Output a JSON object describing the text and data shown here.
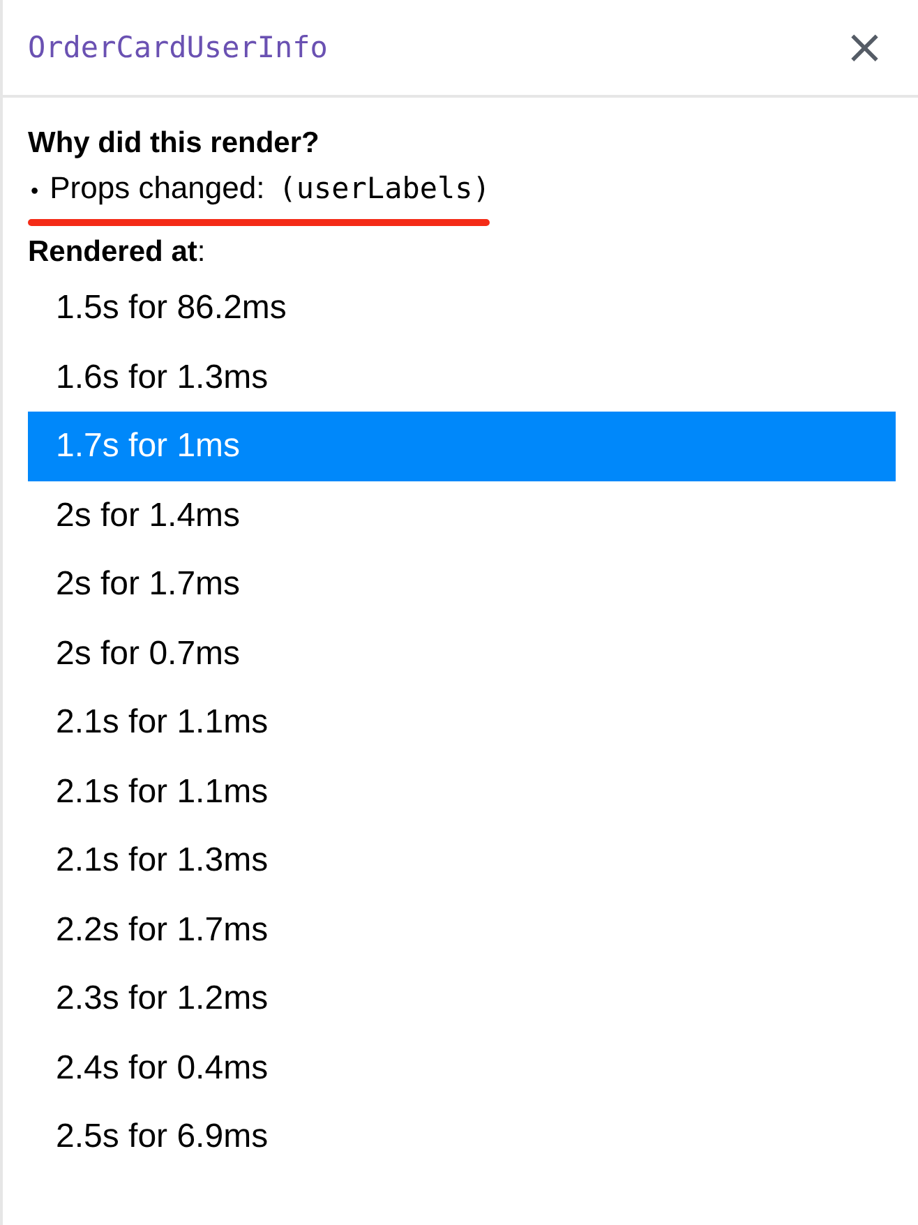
{
  "header": {
    "title": "OrderCardUserInfo",
    "close": "×"
  },
  "why": {
    "heading": "Why did this render?",
    "reasons": [
      {
        "bullet": "•",
        "label": "Props changed:",
        "value": "(userLabels)",
        "underlined": true
      }
    ]
  },
  "renders": {
    "heading": "**Rendered at**:",
    "items": [
      {
        "label": "1.5s for 86.2ms",
        "selected": false
      },
      {
        "label": "1.6s for 1.3ms",
        "selected": false
      },
      {
        "label": "1.7s for 1ms",
        "selected": true
      },
      {
        "label": "2s for 1.4ms",
        "selected": false
      },
      {
        "label": "2s for 1.7ms",
        "selected": false
      },
      {
        "label": "2s for 0.7ms",
        "selected": false
      },
      {
        "label": "2.1s for 1.1ms",
        "selected": false
      },
      {
        "label": "2.1s for 1.1ms",
        "selected": false
      },
      {
        "label": "2.1s for 1.3ms",
        "selected": false
      },
      {
        "label": "2.2s for 1.7ms",
        "selected": false
      },
      {
        "label": "2.3s for 1.2ms",
        "selected": false
      },
      {
        "label": "2.4s for 0.4ms",
        "selected": false
      },
      {
        "label": "2.5s for 6.9ms",
        "selected": false
      }
    ]
  }
}
